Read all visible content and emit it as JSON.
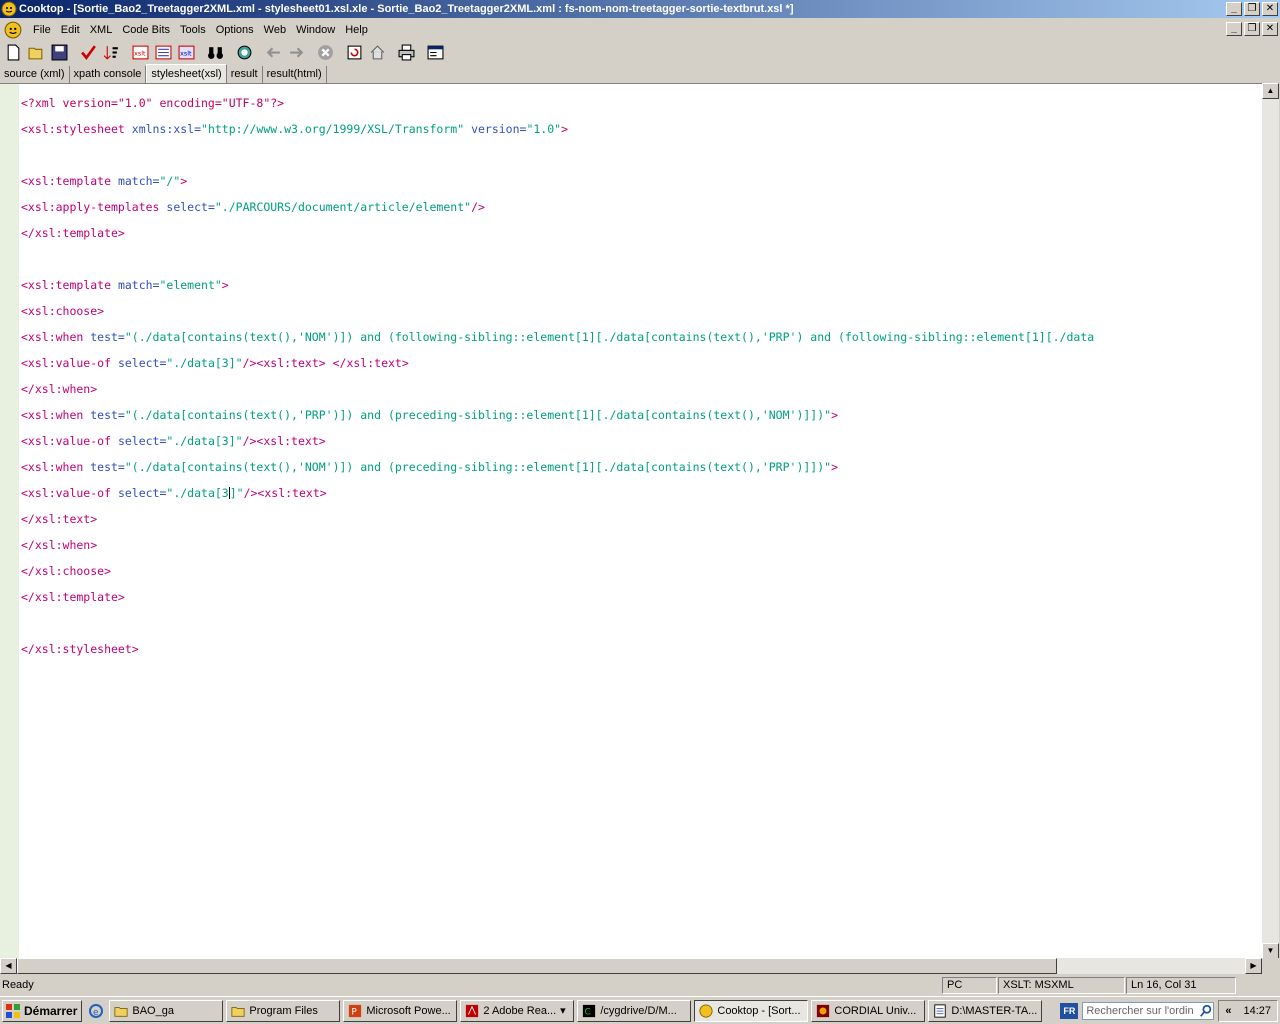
{
  "window": {
    "title": "Cooktop - [Sortie_Bao2_Treetagger2XML.xml - stylesheet01.xsl.xle - Sortie_Bao2_Treetagger2XML.xml : fs-nom-nom-treetagger-sortie-textbrut.xsl *]",
    "minimize": "_",
    "restore": "❐",
    "close": "✕"
  },
  "menu": {
    "items": [
      "File",
      "Edit",
      "XML",
      "Code Bits",
      "Tools",
      "Options",
      "Web",
      "Window",
      "Help"
    ]
  },
  "toolbar": {
    "xslt_label": "xslt"
  },
  "tabs": [
    "source (xml)",
    "xpath console",
    "stylesheet(xsl)",
    "result",
    "result(html)"
  ],
  "active_tab": "stylesheet(xsl)",
  "code": {
    "l1_pi": "<?xml version=\"1.0\" encoding=\"UTF-8\"?>",
    "l2_tag": "<xsl:stylesheet",
    "l2_attr1": " xmlns:xsl=",
    "l2_val1": "\"http://www.w3.org/1999/XSL/Transform\"",
    "l2_attr2": " version=",
    "l2_val2": "\"1.0\"",
    "l2_end": ">",
    "l4_tag": "<xsl:template",
    "l4_attr": " match=",
    "l4_val": "\"/\"",
    "l4_end": ">",
    "l5_tag": "<xsl:apply-templates",
    "l5_attr": " select=",
    "l5_val": "\"./PARCOURS/document/article/element\"",
    "l5_end": "/>",
    "l6_tag": "</xsl:template>",
    "l8_tag": "<xsl:template",
    "l8_attr": " match=",
    "l8_val": "\"element\"",
    "l8_end": ">",
    "l9_tag": "<xsl:choose>",
    "l10_tag": "<xsl:when",
    "l10_attr": " test=",
    "l10_val": "\"(./data[contains(text(),'NOM')]) and (following-sibling::element[1][./data[contains(text(),'PRP') and (following-sibling::element[1][./data",
    "l11_tag1": "<xsl:value-of",
    "l11_attr": " select=",
    "l11_val": "\"./data[3]\"",
    "l11_tag2": "/><xsl:text>",
    "l11_text": " ",
    "l11_tag3": "</xsl:text>",
    "l12_tag": "</xsl:when>",
    "l13_tag": "<xsl:when",
    "l13_attr": " test=",
    "l13_val": "\"(./data[contains(text(),'PRP')]) and (preceding-sibling::element[1][./data[contains(text(),'NOM')]])\"",
    "l13_end": ">",
    "l14_tag1": "<xsl:value-of",
    "l14_attr": " select=",
    "l14_val": "\"./data[3]\"",
    "l14_tag2": "/><xsl:text>",
    "l15_tag": "<xsl:when",
    "l15_attr": " test=",
    "l15_val": "\"(./data[contains(text(),'NOM')]) and (preceding-sibling::element[1][./data[contains(text(),'PRP')]])\"",
    "l15_end": ">",
    "l16_tag1": "<xsl:value-of",
    "l16_attr": " select=",
    "l16_val_a": "\"./data[3",
    "l16_val_b": "]\"",
    "l16_tag2": "/><xsl:text>",
    "l17_tag": "</xsl:text>",
    "l18_tag": "</xsl:when>",
    "l19_tag": "</xsl:choose>",
    "l20_tag": "</xsl:template>",
    "l22_tag": "</xsl:stylesheet>"
  },
  "status": {
    "ready": "Ready",
    "mode": "PC",
    "engine": "XSLT: MSXML",
    "position": "Ln 16, Col 31"
  },
  "taskbar": {
    "start": "Démarrer",
    "tasks": [
      {
        "label": "BAO_ga",
        "icon": "folder-icon"
      },
      {
        "label": "Program Files",
        "icon": "folder-icon"
      },
      {
        "label": "Microsoft Powe...",
        "icon": "powerpoint-icon"
      },
      {
        "label": "2 Adobe Rea...",
        "icon": "adobe-icon"
      },
      {
        "label": "/cygdrive/D/M...",
        "icon": "terminal-icon"
      },
      {
        "label": "Cooktop - [Sort...",
        "icon": "cooktop-icon"
      },
      {
        "label": "CORDIAL Univ...",
        "icon": "cordial-icon"
      },
      {
        "label": "D:\\MASTER-TA...",
        "icon": "notepad-icon"
      }
    ],
    "lang": "FR",
    "search_placeholder": "Rechercher sur l'ordin",
    "chevrons": "«",
    "clock": "14:27"
  }
}
